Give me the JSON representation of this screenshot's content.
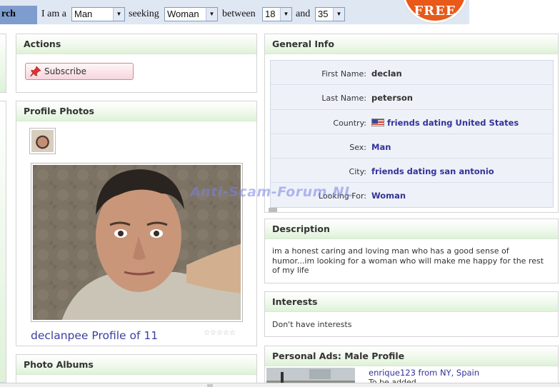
{
  "search": {
    "label_prefix": "rch",
    "i_am_label": "I am a",
    "i_am_value": "Man",
    "seeking_label": "seeking",
    "seeking_value": "Woman",
    "between_label": "between",
    "age_from": "18",
    "and_label": "and",
    "age_to": "35",
    "free_badge": "FREE"
  },
  "actions": {
    "title": "Actions",
    "subscribe_label": "Subscribe"
  },
  "photos": {
    "title": "Profile Photos",
    "caption": "declanpee Profile of 11",
    "rating_stars": "☆☆☆☆☆"
  },
  "albums": {
    "title": "Photo Albums"
  },
  "general": {
    "title": "General Info",
    "rows": [
      {
        "label": "First Name:",
        "value": "declan",
        "type": "plain"
      },
      {
        "label": "Last Name:",
        "value": "peterson",
        "type": "plain"
      },
      {
        "label": "Country:",
        "value": "friends dating United States",
        "type": "link",
        "flag": "us-flag-icon"
      },
      {
        "label": "Sex:",
        "value": "Man",
        "type": "link"
      },
      {
        "label": "City:",
        "value": "friends dating san antonio",
        "type": "link"
      },
      {
        "label": "Looking For:",
        "value": "Woman",
        "type": "link"
      }
    ]
  },
  "watermark": "Anti-Scam-Forum.NL",
  "description": {
    "title": "Description",
    "text": "im a honest caring and loving man who has a good sense of humor...im looking for a woman who will make  me happy for the rest of my life"
  },
  "interests": {
    "title": "Interests",
    "text": "Don't have interests"
  },
  "personal_ads": {
    "title": "Personal Ads: Male Profile",
    "item_link": "enrique123 from NY, Spain",
    "item_sub": "To be added"
  },
  "colors": {
    "link": "#333399",
    "header_gradient_end": "#def2d8",
    "free_badge": "#e8591a"
  }
}
